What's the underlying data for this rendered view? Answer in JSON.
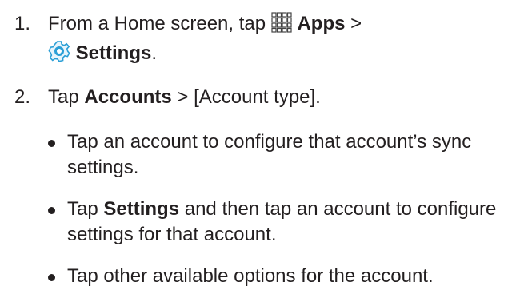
{
  "steps": [
    {
      "number": "1.",
      "parts": {
        "intro": "From a Home screen, tap",
        "apps_label": "Apps",
        "separator": ">",
        "apps_icon": "apps-grid-icon",
        "settings_icon": "settings-gear-icon",
        "settings_label": "Settings",
        "end": "."
      }
    },
    {
      "number": "2.",
      "parts": {
        "intro": "Tap",
        "accounts_label": "Accounts",
        "rest": "> [Account type]."
      }
    }
  ],
  "bullets": [
    {
      "text": "Tap an account to configure that account’s sync settings."
    },
    {
      "prefix": "Tap",
      "bold": "Settings",
      "suffix": "and then tap an account to configure settings for that account."
    },
    {
      "text": "Tap other available options for the account."
    }
  ],
  "colors": {
    "text": "#231f20",
    "settings_icon_blue": "#2b9fd6",
    "apps_icon_gray": "#444444"
  }
}
